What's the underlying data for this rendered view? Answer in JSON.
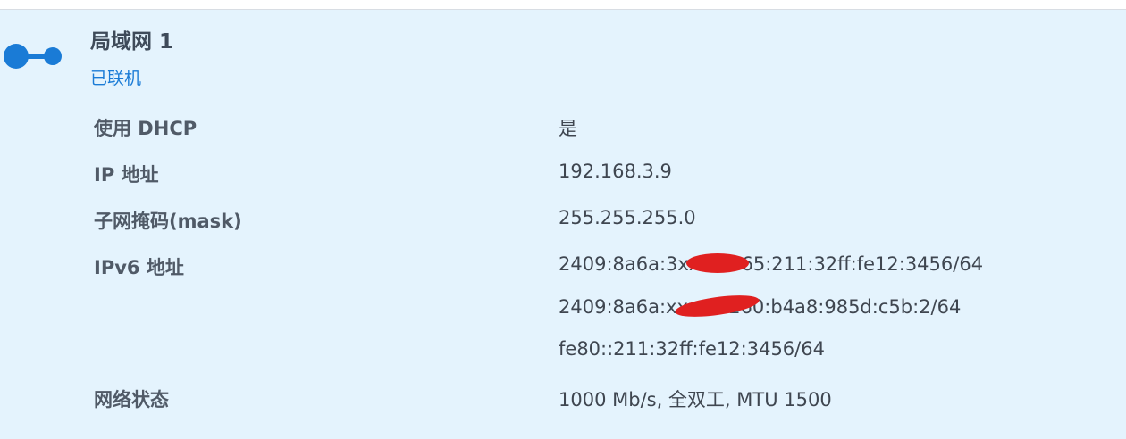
{
  "interface": {
    "title": "局域网 1",
    "status": "已联机",
    "status_color": "#1a7bd6",
    "icon": "network-connection-icon"
  },
  "details": {
    "dhcp": {
      "label": "使用 DHCP",
      "value": "是"
    },
    "ip": {
      "label": "IP 地址",
      "value": "192.168.3.9"
    },
    "mask": {
      "label": "子网掩码(mask)",
      "value": "255.255.255.0"
    },
    "ipv6": {
      "label": "IPv6 地址",
      "values": [
        "2409:8a6a:3xxx:7265:211:32ff:fe12:3456/64",
        "2409:8a6a:xxxx:7260:b4a8:985d:c5b:2/64",
        "fe80::211:32ff:fe12:3456/64"
      ]
    },
    "network_status": {
      "label": "网络状态",
      "value": "1000 Mb/s, 全双工, MTU 1500"
    }
  }
}
